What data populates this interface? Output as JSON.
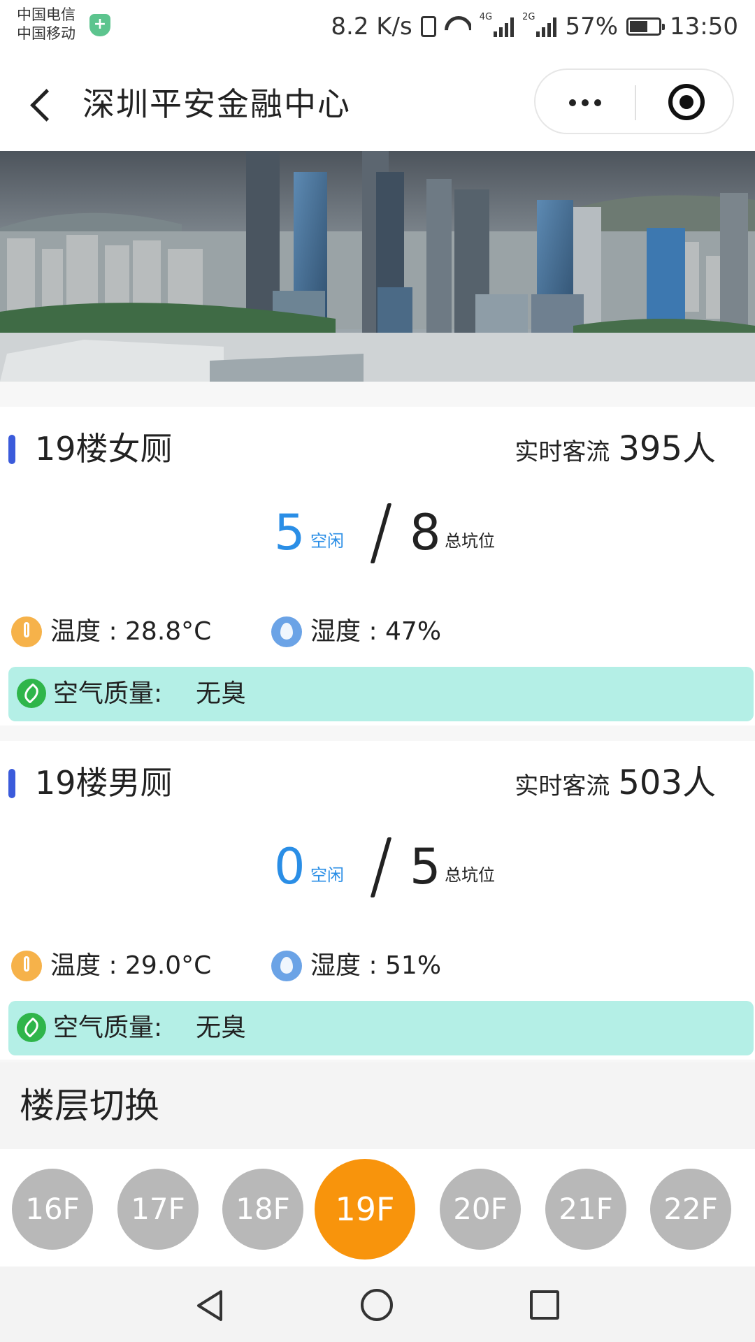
{
  "status_bar": {
    "carrier1": "中国电信",
    "carrier2": "中国移动",
    "net_speed": "8.2 K/s",
    "net_type_1": "4G",
    "net_type_2": "2G",
    "battery": "57%",
    "battery_level": 0.57,
    "time": "13:50"
  },
  "nav": {
    "title": "深圳平安金融中心",
    "icons": {
      "back": "chevron-left-icon",
      "more": "more-dots-icon",
      "close": "miniprogram-close-icon"
    }
  },
  "cards": [
    {
      "title": "19楼女厕",
      "flow_label": "实时客流",
      "flow_value": "395人",
      "free_count": "5",
      "free_label": "空闲",
      "total_count": "8",
      "total_label": "总坑位",
      "temperature": "温度 : 28.8°C",
      "humidity": "湿度 : 47%",
      "air_label": "空气质量:",
      "air_value": "无臭"
    },
    {
      "title": "19楼男厕",
      "flow_label": "实时客流",
      "flow_value": "503人",
      "free_count": "0",
      "free_label": "空闲",
      "total_count": "5",
      "total_label": "总坑位",
      "temperature": "温度 : 29.0°C",
      "humidity": "湿度 : 51%",
      "air_label": "空气质量:",
      "air_value": "无臭"
    }
  ],
  "floor_switch": {
    "title": "楼层切换",
    "floors": [
      "16F",
      "17F",
      "18F",
      "19F",
      "20F",
      "21F",
      "22F"
    ],
    "selected": "19F"
  },
  "colors": {
    "accent_blue": "#2a8ee6",
    "indicator": "#3b5bdb",
    "air_bg": "#b4efe6",
    "floor_active": "#f8940c",
    "floor_inactive": "#b8b8b8"
  }
}
